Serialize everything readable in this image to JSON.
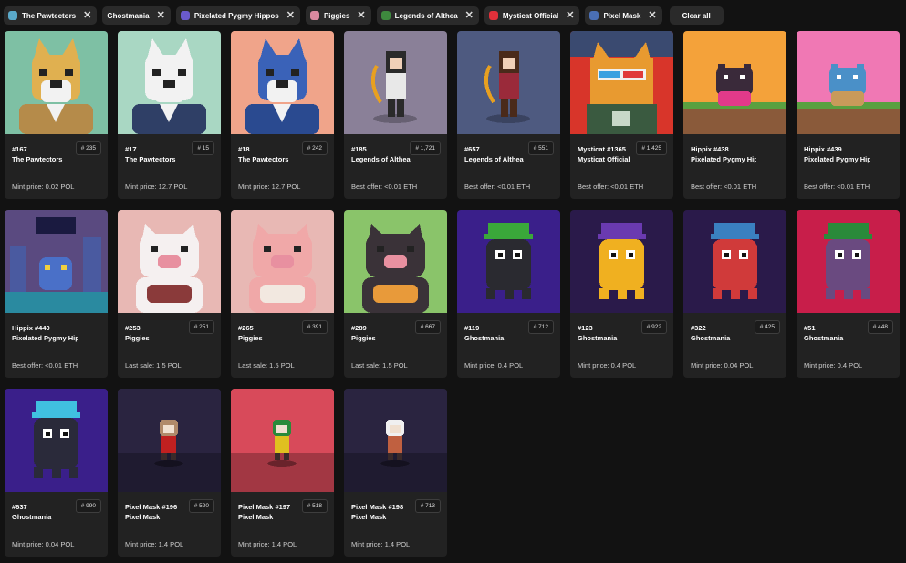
{
  "filters": [
    {
      "label": "The Pawtectors",
      "icon": "pawtectors-icon",
      "color": "#5aa9c9"
    },
    {
      "label": "Ghostmania",
      "icon": "",
      "color": ""
    },
    {
      "label": "Pixelated Pygmy Hippos",
      "icon": "hippo-icon",
      "color": "#6a5acd"
    },
    {
      "label": "Piggies",
      "icon": "piggies-icon",
      "color": "#d98aa0"
    },
    {
      "label": "Legends of Althea",
      "icon": "althea-icon",
      "color": "#3e8a3e"
    },
    {
      "label": "Mysticat Official",
      "icon": "mysticat-icon",
      "color": "#e0303a"
    },
    {
      "label": "Pixel Mask",
      "icon": "pixel-mask-icon",
      "color": "#4a6fb5"
    }
  ],
  "clear_all": "Clear all",
  "close_glyph": "✕",
  "cards": [
    {
      "name": "#167",
      "collection": "The Pawtectors",
      "rank": "# 235",
      "price": "Mint price: 0.02 POL",
      "art": "dog",
      "bg": "#7ec0a4",
      "c1": "#e0b050",
      "c2": "#b58b4a"
    },
    {
      "name": "#17",
      "collection": "The Pawtectors",
      "rank": "# 15",
      "price": "Mint price: 12.7 POL",
      "art": "dog",
      "bg": "#a9d7c3",
      "c1": "#f2f2f2",
      "c2": "#2f3f66"
    },
    {
      "name": "#18",
      "collection": "The Pawtectors",
      "rank": "# 242",
      "price": "Mint price: 12.7 POL",
      "art": "dog",
      "bg": "#f0a48a",
      "c1": "#3a62b8",
      "c2": "#2a4a90"
    },
    {
      "name": "#185",
      "collection": "Legends of Althea",
      "rank": "# 1,721",
      "price": "Best offer: <0.01 ETH",
      "art": "warrior",
      "bg": "#8a8098",
      "c1": "#2a2a2a",
      "c2": "#e8e8e8"
    },
    {
      "name": "#657",
      "collection": "Legends of Althea",
      "rank": "# 551",
      "price": "Best offer: <0.01 ETH",
      "art": "warrior",
      "bg": "#4e5a80",
      "c1": "#4a2a1a",
      "c2": "#9a2a3a"
    },
    {
      "name": "Mysticat #1365",
      "collection": "Mysticat Official",
      "rank": "# 1,425",
      "price": "Best offer: <0.01 ETH",
      "art": "cat",
      "bg": "#d8352a",
      "c1": "#e89a30",
      "c2": "#3a5a40"
    },
    {
      "name": "Hippix #438",
      "collection": "Pixelated Pygmy Hip...",
      "rank": "",
      "price": "Best offer: <0.01 ETH",
      "art": "hippo",
      "bg": "#f4a23a",
      "c1": "#3a2a3a",
      "c2": "#e23a8a"
    },
    {
      "name": "Hippix #439",
      "collection": "Pixelated Pygmy Hip...",
      "rank": "",
      "price": "Best offer: <0.01 ETH",
      "art": "hippo",
      "bg": "#f078b4",
      "c1": "#4a90c8",
      "c2": "#c89a5a"
    },
    {
      "name": "Hippix #440",
      "collection": "Pixelated Pygmy Hip...",
      "rank": "",
      "price": "Best offer: <0.01 ETH",
      "art": "city",
      "bg": "#5a4a80",
      "c1": "#4a5aa0",
      "c2": "#2a8aa0"
    },
    {
      "name": "#253",
      "collection": "Piggies",
      "rank": "# 251",
      "price": "Last sale: 1.5 POL",
      "art": "pig",
      "bg": "#e8b8b4",
      "c1": "#f5f0f0",
      "c2": "#8a3a3a"
    },
    {
      "name": "#265",
      "collection": "Piggies",
      "rank": "# 391",
      "price": "Last sale: 1.5 POL",
      "art": "pig",
      "bg": "#e8b8b4",
      "c1": "#f0a8a8",
      "c2": "#f2e8e0"
    },
    {
      "name": "#289",
      "collection": "Piggies",
      "rank": "# 667",
      "price": "Last sale: 1.5 POL",
      "art": "pig",
      "bg": "#8ac46a",
      "c1": "#3a3238",
      "c2": "#e89a3a"
    },
    {
      "name": "#119",
      "collection": "Ghostmania",
      "rank": "# 712",
      "price": "Mint price: 0.4 POL",
      "art": "ghost",
      "bg": "#3a1f8a",
      "c1": "#2a2a30",
      "c2": "#3aa83a"
    },
    {
      "name": "#123",
      "collection": "Ghostmania",
      "rank": "# 922",
      "price": "Mint price: 0.4 POL",
      "art": "ghost",
      "bg": "#2a1a4a",
      "c1": "#f0b020",
      "c2": "#6a3ab0"
    },
    {
      "name": "#322",
      "collection": "Ghostmania",
      "rank": "# 425",
      "price": "Mint price: 0.04 POL",
      "art": "ghost",
      "bg": "#2a1a4a",
      "c1": "#d03a3a",
      "c2": "#3a80c0"
    },
    {
      "name": "#51",
      "collection": "Ghostmania",
      "rank": "# 448",
      "price": "Mint price: 0.4 POL",
      "art": "ghost",
      "bg": "#c81e4a",
      "c1": "#6a4a80",
      "c2": "#2a8a3a"
    },
    {
      "name": "#637",
      "collection": "Ghostmania",
      "rank": "# 990",
      "price": "Mint price: 0.04 POL",
      "art": "ghost",
      "bg": "#3a1f8a",
      "c1": "#2a2a3a",
      "c2": "#40c0e0"
    },
    {
      "name": "Pixel Mask #196",
      "collection": "Pixel Mask",
      "rank": "# 520",
      "price": "Mint price: 1.4 POL",
      "art": "mask",
      "bg": "#2a2440",
      "c1": "#c02020",
      "c2": "#b08a6a"
    },
    {
      "name": "Pixel Mask #197",
      "collection": "Pixel Mask",
      "rank": "# 518",
      "price": "Mint price: 1.4 POL",
      "art": "mask",
      "bg": "#d84a5a",
      "c1": "#e0c020",
      "c2": "#2a8a3a"
    },
    {
      "name": "Pixel Mask #198",
      "collection": "Pixel Mask",
      "rank": "# 713",
      "price": "Mint price: 1.4 POL",
      "art": "mask",
      "bg": "#2a2440",
      "c1": "#c06040",
      "c2": "#f0f0f0"
    }
  ]
}
